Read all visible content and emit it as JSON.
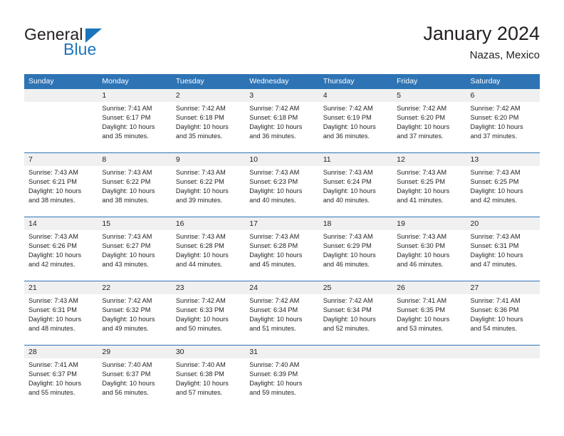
{
  "brand": {
    "name_top": "General",
    "name_bottom": "Blue",
    "accent_color": "#1b75bb"
  },
  "header": {
    "title": "January 2024",
    "subtitle": "Nazas, Mexico"
  },
  "theme": {
    "header_blue": "#2e74b5",
    "daynum_strip": "#f0f0f0",
    "text": "#231f20"
  },
  "weekdays": [
    "Sunday",
    "Monday",
    "Tuesday",
    "Wednesday",
    "Thursday",
    "Friday",
    "Saturday"
  ],
  "weeks": [
    [
      {
        "day": "",
        "lines": []
      },
      {
        "day": "1",
        "lines": [
          "Sunrise: 7:41 AM",
          "Sunset: 6:17 PM",
          "Daylight: 10 hours",
          "and 35 minutes."
        ]
      },
      {
        "day": "2",
        "lines": [
          "Sunrise: 7:42 AM",
          "Sunset: 6:18 PM",
          "Daylight: 10 hours",
          "and 35 minutes."
        ]
      },
      {
        "day": "3",
        "lines": [
          "Sunrise: 7:42 AM",
          "Sunset: 6:18 PM",
          "Daylight: 10 hours",
          "and 36 minutes."
        ]
      },
      {
        "day": "4",
        "lines": [
          "Sunrise: 7:42 AM",
          "Sunset: 6:19 PM",
          "Daylight: 10 hours",
          "and 36 minutes."
        ]
      },
      {
        "day": "5",
        "lines": [
          "Sunrise: 7:42 AM",
          "Sunset: 6:20 PM",
          "Daylight: 10 hours",
          "and 37 minutes."
        ]
      },
      {
        "day": "6",
        "lines": [
          "Sunrise: 7:42 AM",
          "Sunset: 6:20 PM",
          "Daylight: 10 hours",
          "and 37 minutes."
        ]
      }
    ],
    [
      {
        "day": "7",
        "lines": [
          "Sunrise: 7:43 AM",
          "Sunset: 6:21 PM",
          "Daylight: 10 hours",
          "and 38 minutes."
        ]
      },
      {
        "day": "8",
        "lines": [
          "Sunrise: 7:43 AM",
          "Sunset: 6:22 PM",
          "Daylight: 10 hours",
          "and 38 minutes."
        ]
      },
      {
        "day": "9",
        "lines": [
          "Sunrise: 7:43 AM",
          "Sunset: 6:22 PM",
          "Daylight: 10 hours",
          "and 39 minutes."
        ]
      },
      {
        "day": "10",
        "lines": [
          "Sunrise: 7:43 AM",
          "Sunset: 6:23 PM",
          "Daylight: 10 hours",
          "and 40 minutes."
        ]
      },
      {
        "day": "11",
        "lines": [
          "Sunrise: 7:43 AM",
          "Sunset: 6:24 PM",
          "Daylight: 10 hours",
          "and 40 minutes."
        ]
      },
      {
        "day": "12",
        "lines": [
          "Sunrise: 7:43 AM",
          "Sunset: 6:25 PM",
          "Daylight: 10 hours",
          "and 41 minutes."
        ]
      },
      {
        "day": "13",
        "lines": [
          "Sunrise: 7:43 AM",
          "Sunset: 6:25 PM",
          "Daylight: 10 hours",
          "and 42 minutes."
        ]
      }
    ],
    [
      {
        "day": "14",
        "lines": [
          "Sunrise: 7:43 AM",
          "Sunset: 6:26 PM",
          "Daylight: 10 hours",
          "and 42 minutes."
        ]
      },
      {
        "day": "15",
        "lines": [
          "Sunrise: 7:43 AM",
          "Sunset: 6:27 PM",
          "Daylight: 10 hours",
          "and 43 minutes."
        ]
      },
      {
        "day": "16",
        "lines": [
          "Sunrise: 7:43 AM",
          "Sunset: 6:28 PM",
          "Daylight: 10 hours",
          "and 44 minutes."
        ]
      },
      {
        "day": "17",
        "lines": [
          "Sunrise: 7:43 AM",
          "Sunset: 6:28 PM",
          "Daylight: 10 hours",
          "and 45 minutes."
        ]
      },
      {
        "day": "18",
        "lines": [
          "Sunrise: 7:43 AM",
          "Sunset: 6:29 PM",
          "Daylight: 10 hours",
          "and 46 minutes."
        ]
      },
      {
        "day": "19",
        "lines": [
          "Sunrise: 7:43 AM",
          "Sunset: 6:30 PM",
          "Daylight: 10 hours",
          "and 46 minutes."
        ]
      },
      {
        "day": "20",
        "lines": [
          "Sunrise: 7:43 AM",
          "Sunset: 6:31 PM",
          "Daylight: 10 hours",
          "and 47 minutes."
        ]
      }
    ],
    [
      {
        "day": "21",
        "lines": [
          "Sunrise: 7:43 AM",
          "Sunset: 6:31 PM",
          "Daylight: 10 hours",
          "and 48 minutes."
        ]
      },
      {
        "day": "22",
        "lines": [
          "Sunrise: 7:42 AM",
          "Sunset: 6:32 PM",
          "Daylight: 10 hours",
          "and 49 minutes."
        ]
      },
      {
        "day": "23",
        "lines": [
          "Sunrise: 7:42 AM",
          "Sunset: 6:33 PM",
          "Daylight: 10 hours",
          "and 50 minutes."
        ]
      },
      {
        "day": "24",
        "lines": [
          "Sunrise: 7:42 AM",
          "Sunset: 6:34 PM",
          "Daylight: 10 hours",
          "and 51 minutes."
        ]
      },
      {
        "day": "25",
        "lines": [
          "Sunrise: 7:42 AM",
          "Sunset: 6:34 PM",
          "Daylight: 10 hours",
          "and 52 minutes."
        ]
      },
      {
        "day": "26",
        "lines": [
          "Sunrise: 7:41 AM",
          "Sunset: 6:35 PM",
          "Daylight: 10 hours",
          "and 53 minutes."
        ]
      },
      {
        "day": "27",
        "lines": [
          "Sunrise: 7:41 AM",
          "Sunset: 6:36 PM",
          "Daylight: 10 hours",
          "and 54 minutes."
        ]
      }
    ],
    [
      {
        "day": "28",
        "lines": [
          "Sunrise: 7:41 AM",
          "Sunset: 6:37 PM",
          "Daylight: 10 hours",
          "and 55 minutes."
        ]
      },
      {
        "day": "29",
        "lines": [
          "Sunrise: 7:40 AM",
          "Sunset: 6:37 PM",
          "Daylight: 10 hours",
          "and 56 minutes."
        ]
      },
      {
        "day": "30",
        "lines": [
          "Sunrise: 7:40 AM",
          "Sunset: 6:38 PM",
          "Daylight: 10 hours",
          "and 57 minutes."
        ]
      },
      {
        "day": "31",
        "lines": [
          "Sunrise: 7:40 AM",
          "Sunset: 6:39 PM",
          "Daylight: 10 hours",
          "and 59 minutes."
        ]
      },
      {
        "day": "",
        "lines": []
      },
      {
        "day": "",
        "lines": []
      },
      {
        "day": "",
        "lines": []
      }
    ]
  ]
}
